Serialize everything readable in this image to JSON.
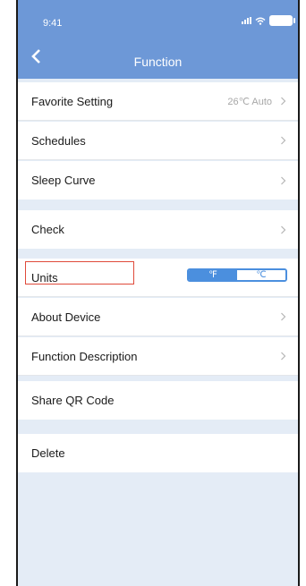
{
  "status_bar": {
    "time": "9:41"
  },
  "header": {
    "title": "Function"
  },
  "rows": [
    {
      "label": "Favorite Setting",
      "value": "26℃ Auto"
    },
    {
      "label": "Schedules"
    },
    {
      "label": "Sleep Curve"
    },
    {
      "label": "Check"
    },
    {
      "label": "Units"
    },
    {
      "label": "About Device"
    },
    {
      "label": "Function Description"
    },
    {
      "label": "Share QR Code"
    },
    {
      "label": "Delete"
    }
  ],
  "units_toggle": {
    "options": [
      "℉",
      "℃"
    ],
    "selected": "℉"
  },
  "colors": {
    "header": "#6d98d7",
    "accent": "#4b8fde",
    "background": "#e4ecf6",
    "highlight": "#e04a3a"
  }
}
